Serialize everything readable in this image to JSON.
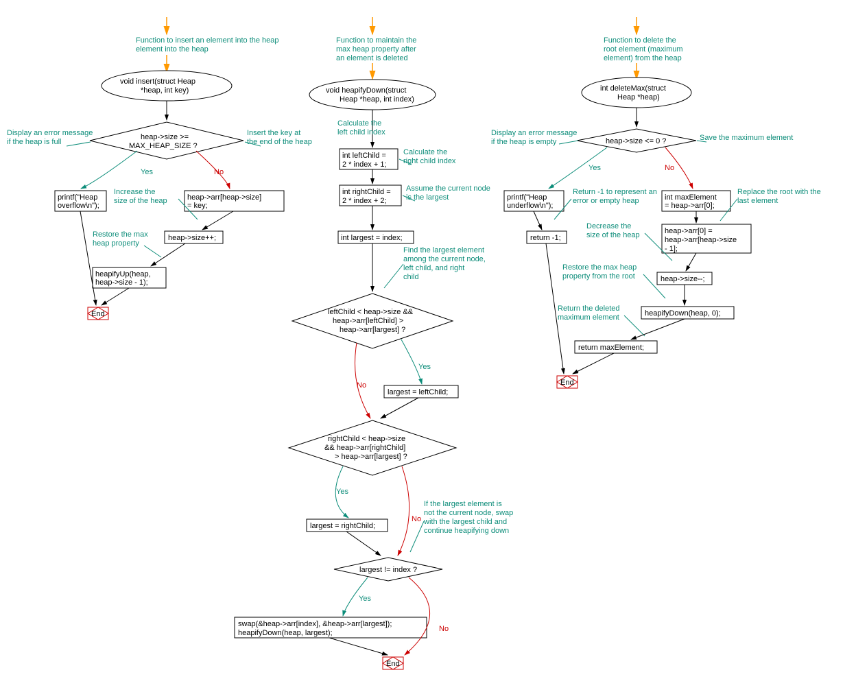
{
  "colors": {
    "annotation": "#0d8d7a",
    "yes": "#0d8d7a",
    "no": "#cc0000",
    "arrow_orange": "#ff9900",
    "end_box": "#cc0000"
  },
  "flowcharts": {
    "insert": {
      "annotations": {
        "title": "Function to insert an element into the heap",
        "full": "Display an error message if the heap is full",
        "endkey": "Insert the key at the end of the heap",
        "incsize": "Increase the size of the heap",
        "restore": "Restore the max heap property"
      },
      "nodes": {
        "start": "void insert(struct Heap *heap, int key)",
        "cond": "heap->size >= MAX_HEAP_SIZE ?",
        "overflow": "printf(\"Heap overflow\\n\");",
        "assign": "heap->arr[heap->size] = key;",
        "inc": "heap->size++;",
        "heapify": "heapifyUp(heap, heap->size - 1);",
        "end": "End"
      },
      "labels": {
        "yes": "Yes",
        "no": "No"
      }
    },
    "heapifyDown": {
      "annotations": {
        "title": "Function to maintain the max heap property after an element is deleted",
        "left": "Calculate the left child index",
        "right": "Calculate the right child index",
        "assume": "Assume the current node is the largest",
        "findlargest": "Find the largest element among the current node, left child, and right child",
        "swapnote": "If the largest element is not the current node, swap with the largest child and continue heapifying down"
      },
      "nodes": {
        "start": "void heapifyDown(struct Heap *heap, int index)",
        "leftchild": "int leftChild = 2 * index + 1;",
        "rightchild": "int rightChild = 2 * index + 2;",
        "largest": "int largest = index;",
        "cond1": "leftChild < heap->size && heap->arr[leftChild] > heap->arr[largest] ?",
        "set1": "largest = leftChild;",
        "cond2": "rightChild < heap->size && heap->arr[rightChild] > heap->arr[largest] ?",
        "set2": "largest = rightChild;",
        "cond3": "largest != index ?",
        "swap": "swap(&heap->arr[index], &heap->arr[largest]); heapifyDown(heap, largest);",
        "end": "End"
      },
      "labels": {
        "yes": "Yes",
        "no": "No"
      }
    },
    "deleteMax": {
      "annotations": {
        "title": "Function to delete the root element (maximum element) from the heap",
        "empty": "Display an error message if the heap is empty",
        "save": "Save the maximum element",
        "retneg": "Return -1 to represent an error or empty heap",
        "replace": "Replace the root with the last element",
        "dec": "Decrease the size of the heap",
        "restore": "Restore the max heap property from the root",
        "retdel": "Return the deleted maximum element"
      },
      "nodes": {
        "start": "int deleteMax(struct Heap *heap)",
        "cond": "heap->size <= 0 ?",
        "underflow": "printf(\"Heap underflow\\n\");",
        "maxel": "int maxElement = heap->arr[0];",
        "retneg": "return -1;",
        "setroot": "heap->arr[0] = heap->arr[heap->size - 1];",
        "dec": "heap->size--;",
        "heapify": "heapifyDown(heap, 0);",
        "retmax": "return maxElement;",
        "end": "End"
      },
      "labels": {
        "yes": "Yes",
        "no": "No"
      }
    }
  }
}
